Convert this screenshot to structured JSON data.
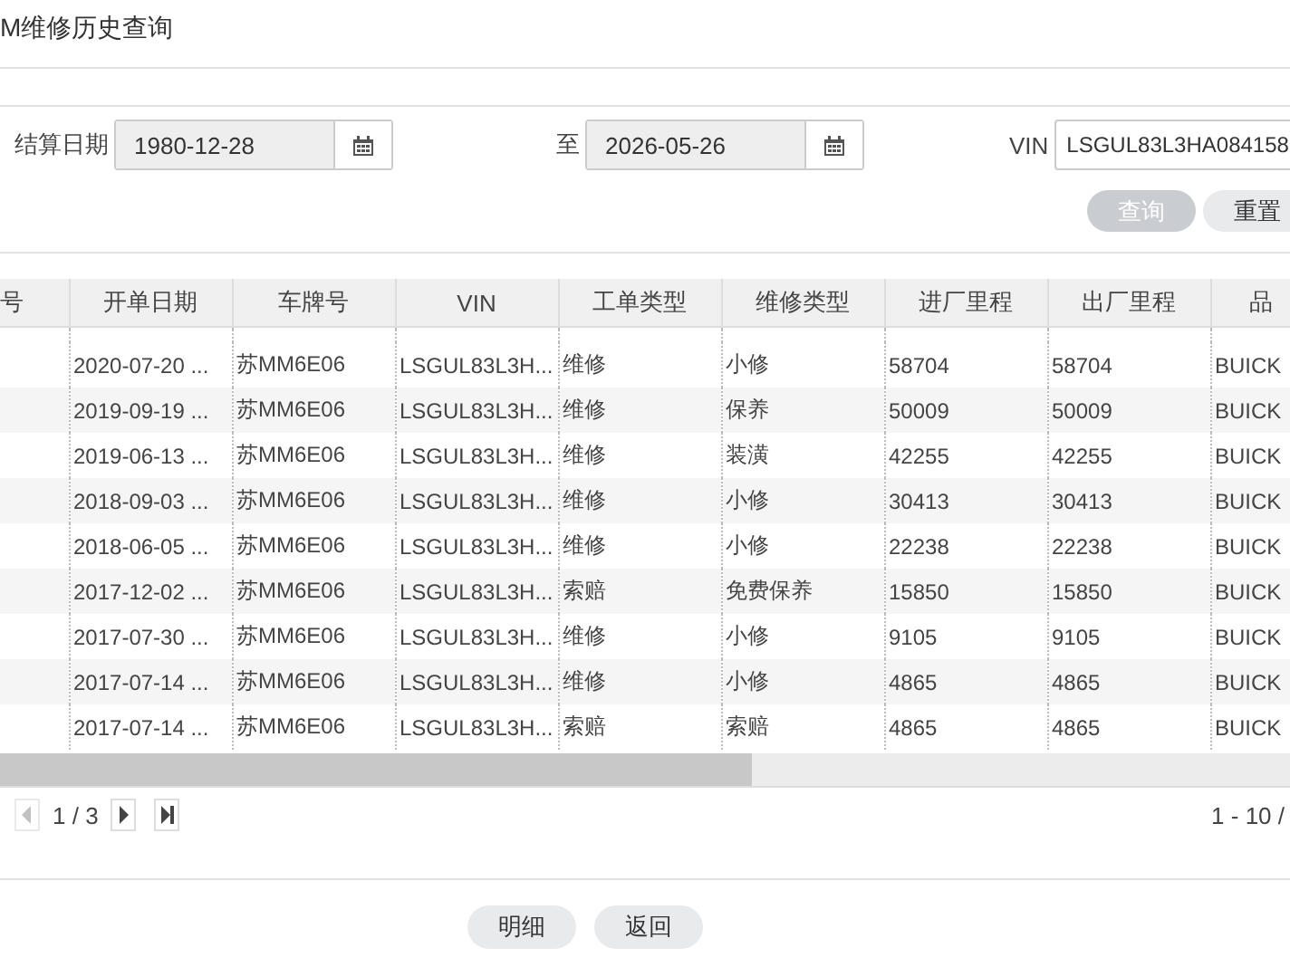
{
  "window": {
    "title": "M维修历史查询"
  },
  "filter": {
    "fields": [
      {
        "label": "结算日期",
        "value": "1980-12-28",
        "kind": "date"
      },
      {
        "label": "至",
        "value": "2026-05-26",
        "kind": "date"
      },
      {
        "label": "VIN",
        "value": "LSGUL83L3HA084158",
        "kind": "text"
      }
    ],
    "buttons": [
      {
        "label": "查询",
        "kind": "primary"
      },
      {
        "label": "重置",
        "kind": "default"
      }
    ]
  },
  "table": {
    "columns": [
      "号",
      "开单日期",
      "车牌号",
      "VIN",
      "工单类型",
      "维修类型",
      "进厂里程",
      "出厂里程",
      "品"
    ],
    "rows": [
      [
        "",
        "2020-07-20 ...",
        "苏MM6E06",
        "LSGUL83L3H...",
        "维修",
        "小修",
        "58704",
        "58704",
        "BUICK"
      ],
      [
        "",
        "2019-09-19 ...",
        "苏MM6E06",
        "LSGUL83L3H...",
        "维修",
        "保养",
        "50009",
        "50009",
        "BUICK"
      ],
      [
        "",
        "2019-06-13 ...",
        "苏MM6E06",
        "LSGUL83L3H...",
        "维修",
        "装潢",
        "42255",
        "42255",
        "BUICK"
      ],
      [
        "",
        "2018-09-03 ...",
        "苏MM6E06",
        "LSGUL83L3H...",
        "维修",
        "小修",
        "30413",
        "30413",
        "BUICK"
      ],
      [
        "",
        "2018-06-05 ...",
        "苏MM6E06",
        "LSGUL83L3H...",
        "维修",
        "小修",
        "22238",
        "22238",
        "BUICK"
      ],
      [
        "",
        "2017-12-02 ...",
        "苏MM6E06",
        "LSGUL83L3H...",
        "索赔",
        "免费保养",
        "15850",
        "15850",
        "BUICK"
      ],
      [
        "",
        "2017-07-30 ...",
        "苏MM6E06",
        "LSGUL83L3H...",
        "维修",
        "小修",
        "9105",
        "9105",
        "BUICK"
      ],
      [
        "",
        "2017-07-14 ...",
        "苏MM6E06",
        "LSGUL83L3H...",
        "维修",
        "小修",
        "4865",
        "4865",
        "BUICK"
      ],
      [
        "",
        "2017-07-14 ...",
        "苏MM6E06",
        "LSGUL83L3H...",
        "索赔",
        "索赔",
        "4865",
        "4865",
        "BUICK"
      ]
    ]
  },
  "pager": {
    "buttons": [
      {
        "kind": "prev",
        "disabled": true
      },
      {
        "kind": "next",
        "disabled": false
      },
      {
        "kind": "last",
        "disabled": false
      }
    ],
    "page": "1 / 3",
    "range": "1 - 10 /"
  },
  "footer": {
    "buttons": [
      "明细",
      "返回"
    ]
  }
}
